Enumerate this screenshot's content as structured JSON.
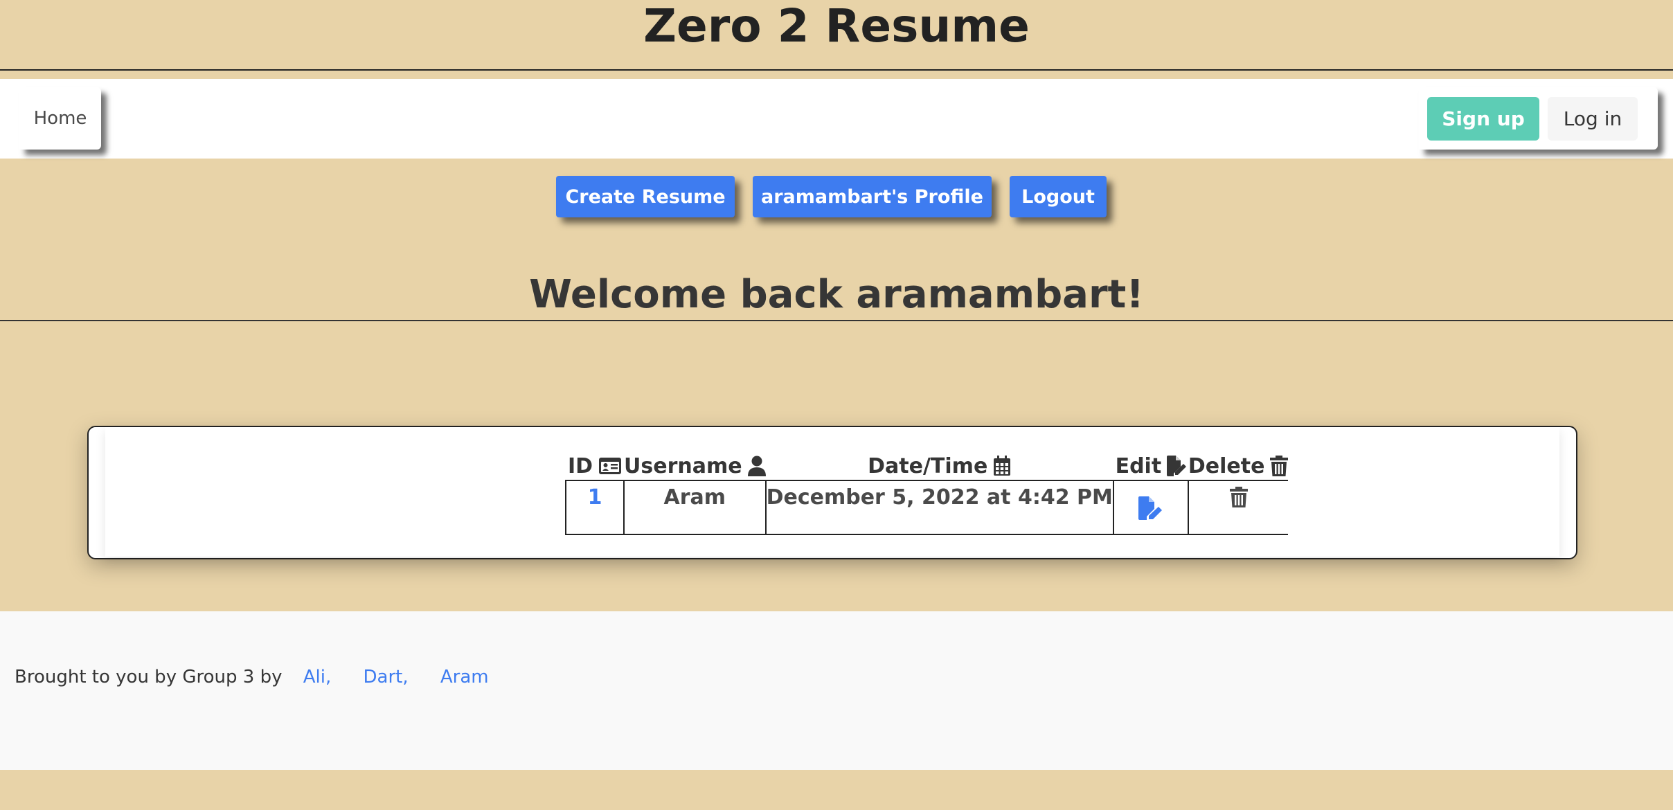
{
  "header": {
    "title": "Zero 2 Resume"
  },
  "navbar": {
    "home_label": "Home",
    "signup_label": "Sign up",
    "login_label": "Log in"
  },
  "actions": {
    "create_label": "Create Resume",
    "profile_label": "aramambart's Profile",
    "logout_label": "Logout"
  },
  "welcome": {
    "text": "Welcome back aramambart!"
  },
  "table": {
    "headers": {
      "id": "ID",
      "username": "Username",
      "datetime": "Date/Time",
      "edit": "Edit",
      "delete": "Delete"
    },
    "rows": [
      {
        "id": "1",
        "username": "Aram",
        "datetime": "December 5, 2022 at 4:42 PM"
      }
    ]
  },
  "footer": {
    "text": "Brought to you by Group 3 by",
    "links": [
      "Ali,",
      "Dart,",
      "Aram"
    ]
  },
  "colors": {
    "background": "#e8d3a8",
    "primary": "#3e7cf0",
    "signup": "#5dcdb5",
    "footer_bg": "#f9f9f9"
  },
  "icons": [
    "id-card-icon",
    "user-icon",
    "calendar-icon",
    "file-pen-icon",
    "trash-icon"
  ]
}
